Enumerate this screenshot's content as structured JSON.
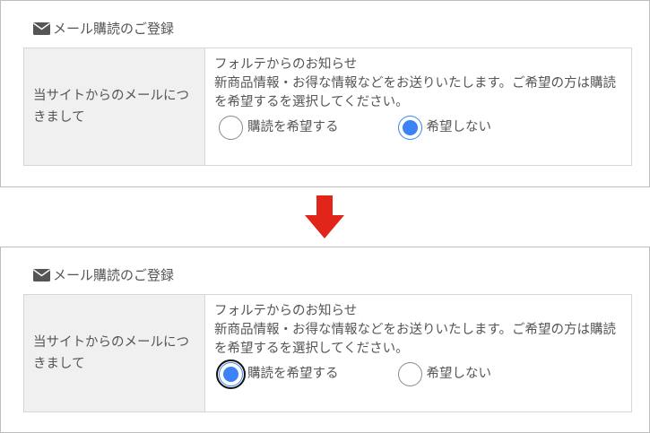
{
  "section_title": "メール購読のご登録",
  "row_label": "当サイトからのメールにつきまして",
  "notice_title": "フォルテからのお知らせ",
  "notice_body": "新商品情報・お得な情報などをお送りいたします。ご希望の方は購読を希望するを選択してください。",
  "options": [
    "購読を希望する",
    "希望しない"
  ],
  "before": {
    "selected": "希望しない"
  },
  "after": {
    "selected": "購読を希望する"
  },
  "colors": {
    "radio_accent": "#3b82f6",
    "arrow": "#e1251b"
  },
  "icons": {
    "mail": "envelope-icon",
    "transition": "down-arrow-icon"
  }
}
